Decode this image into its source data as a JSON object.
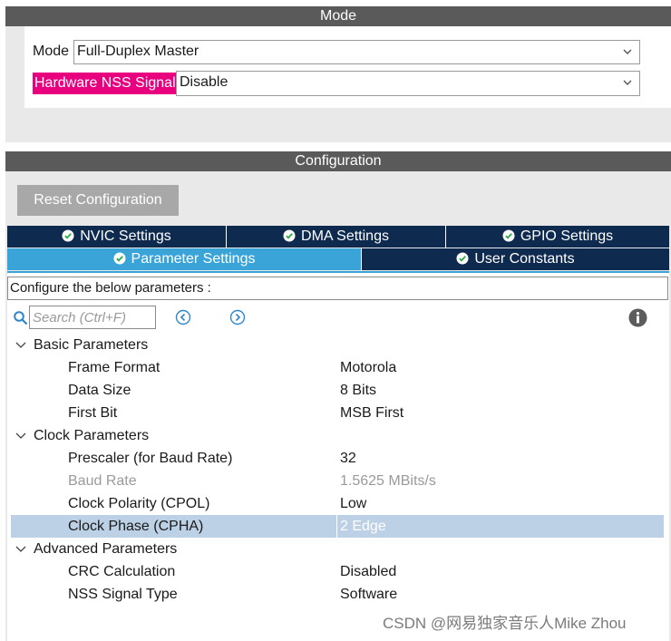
{
  "mode_section": {
    "title": "Mode",
    "mode_label": "Mode",
    "mode_value": "Full-Duplex Master",
    "nss_label": "Hardware NSS Signal",
    "nss_value": "Disable"
  },
  "config_section": {
    "title": "Configuration",
    "reset_label": "Reset Configuration",
    "tabs_top": [
      {
        "label": "NVIC Settings"
      },
      {
        "label": "DMA Settings"
      },
      {
        "label": "GPIO Settings"
      }
    ],
    "tabs_bottom": [
      {
        "label": "Parameter Settings",
        "active": true
      },
      {
        "label": "User Constants",
        "active": false
      }
    ],
    "configure_text": "Configure the below parameters :",
    "search_placeholder": "Search (Ctrl+F)"
  },
  "params": {
    "basic": {
      "title": "Basic Parameters",
      "items": [
        {
          "label": "Frame Format",
          "value": "Motorola"
        },
        {
          "label": "Data Size",
          "value": "8 Bits"
        },
        {
          "label": "First Bit",
          "value": "MSB First"
        }
      ]
    },
    "clock": {
      "title": "Clock Parameters",
      "items": [
        {
          "label": "Prescaler (for Baud Rate)",
          "value": "32"
        },
        {
          "label": "Baud Rate",
          "value": "1.5625 MBits/s",
          "disabled": true
        },
        {
          "label": "Clock Polarity (CPOL)",
          "value": "Low"
        },
        {
          "label": "Clock Phase (CPHA)",
          "value": "2 Edge",
          "selected": true
        }
      ]
    },
    "advanced": {
      "title": "Advanced Parameters",
      "items": [
        {
          "label": "CRC Calculation",
          "value": "Disabled"
        },
        {
          "label": "NSS Signal Type",
          "value": "Software"
        }
      ]
    }
  },
  "watermark": "CSDN @网易独家音乐人Mike Zhou",
  "colors": {
    "section_bar": "#5a5a5a",
    "nss_highlight": "#e8007f",
    "tab_dark": "#0e2a4e",
    "tab_active": "#3aa4d8",
    "row_selected": "#bcd0e6"
  }
}
